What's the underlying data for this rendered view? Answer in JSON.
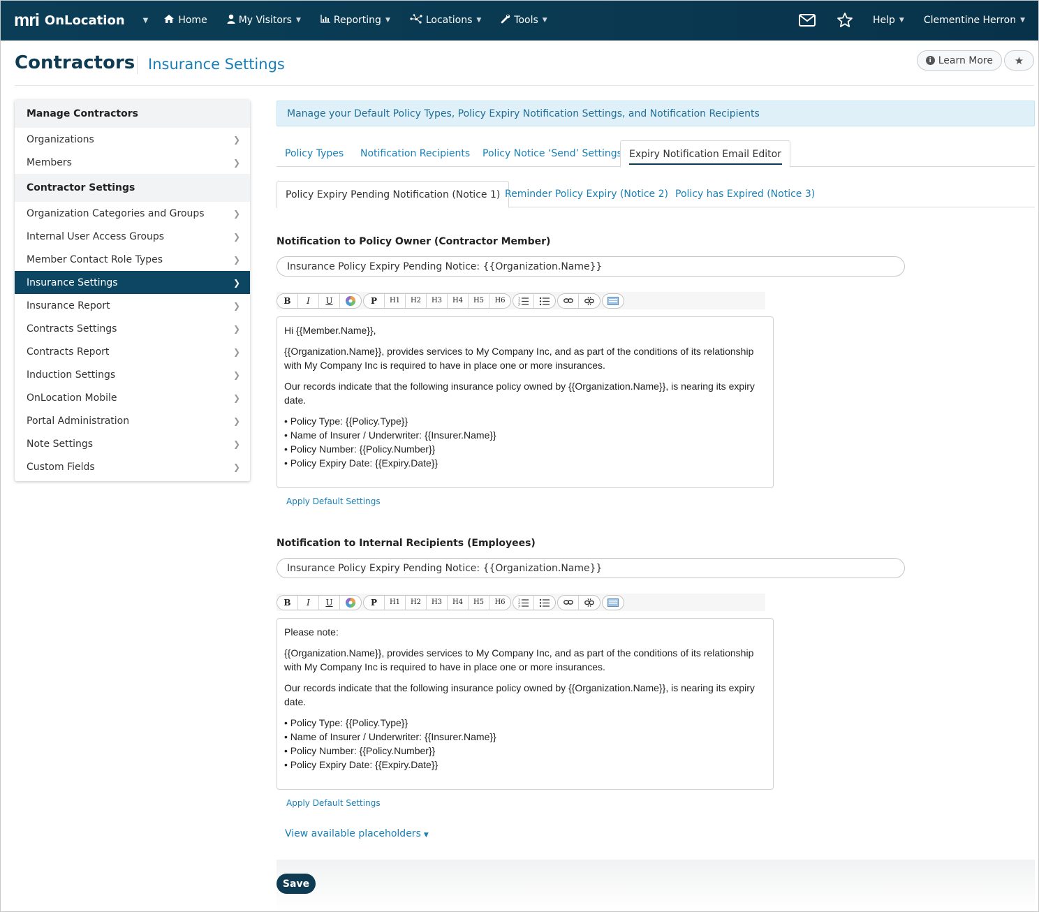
{
  "nav": {
    "brand_logo": "mri",
    "brand_name": "OnLocation",
    "items": [
      {
        "label": "Home",
        "icon": "home-icon"
      },
      {
        "label": "My Visitors",
        "icon": "user-icon"
      },
      {
        "label": "Reporting",
        "icon": "bar-chart-icon"
      },
      {
        "label": "Locations",
        "icon": "network-icon"
      },
      {
        "label": "Tools",
        "icon": "wrench-icon"
      }
    ],
    "help_label": "Help",
    "user_name": "Clementine Herron"
  },
  "header": {
    "title": "Contractors",
    "subtitle": "Insurance Settings",
    "learn_more": "Learn More"
  },
  "sidebar": {
    "section1": "Manage Contractors",
    "section1_items": [
      "Organizations",
      "Members"
    ],
    "section2": "Contractor Settings",
    "section2_items": [
      "Organization Categories and Groups",
      "Internal User Access Groups",
      "Member Contact Role Types",
      "Insurance Settings",
      "Insurance Report",
      "Contracts Settings",
      "Contracts Report",
      "Induction Settings",
      "OnLocation Mobile",
      "Portal Administration",
      "Note Settings",
      "Custom Fields"
    ],
    "active_item": "Insurance Settings"
  },
  "banner": "Manage your Default Policy Types, Policy Expiry Notification Settings, and Notification Recipients",
  "tabs": [
    "Policy Types",
    "Notification Recipients",
    "Policy Notice ‘Send’ Settings",
    "Expiry Notification Email Editor"
  ],
  "active_tab": "Expiry Notification Email Editor",
  "subtabs": [
    "Policy Expiry Pending Notification (Notice 1)",
    "Reminder Policy Expiry (Notice 2)",
    "Policy has Expired (Notice 3)"
  ],
  "active_subtab": "Policy Expiry Pending Notification (Notice 1)",
  "toolbar": {
    "bold": "B",
    "italic": "I",
    "underline": "U",
    "paragraph": "P",
    "h1": "H1",
    "h2": "H2",
    "h3": "H3",
    "h4": "H4",
    "h5": "H5",
    "h6": "H6"
  },
  "owner": {
    "title": "Notification to Policy Owner (Contractor Member)",
    "subject": "Insurance Policy Expiry Pending Notice: {{Organization.Name}}",
    "greeting": "Hi {{Member.Name}},",
    "para1": "{{Organization.Name}}, provides services to My Company Inc, and as part of the conditions of its relationship with My Company Inc is required to have in place one or more insurances.",
    "para2": "Our records indicate that the following insurance policy owned by {{Organization.Name}}, is nearing its expiry date.",
    "list": [
      "• Policy Type: {{Policy.Type}}",
      "• Name of Insurer / Underwriter: {{Insurer.Name}}",
      "• Policy Number: {{Policy.Number}}",
      "• Policy Expiry Date: {{Expiry.Date}}"
    ],
    "apply": "Apply Default Settings"
  },
  "internal": {
    "title": "Notification to Internal Recipients (Employees)",
    "subject": "Insurance Policy Expiry Pending Notice: {{Organization.Name}}",
    "greeting": "Please note:",
    "para1": "{{Organization.Name}}, provides services to My Company Inc, and as part of the conditions of its relationship with My Company Inc is required to have in place one or more insurances.",
    "para2": "Our records indicate that the following insurance policy owned by {{Organization.Name}}, is nearing its expiry date.",
    "list": [
      "• Policy Type: {{Policy.Type}}",
      "• Name of Insurer / Underwriter: {{Insurer.Name}}",
      "• Policy Number: {{Policy.Number}}",
      "• Policy Expiry Date: {{Expiry.Date}}"
    ],
    "apply": "Apply Default Settings"
  },
  "placeholders_link": "View available placeholders",
  "save_label": "Save",
  "colors": {
    "nav_bg": "#0b3d56",
    "accent": "#1a7fb7",
    "active_sidebar": "#0c4662",
    "banner_bg": "#dff0f8"
  }
}
